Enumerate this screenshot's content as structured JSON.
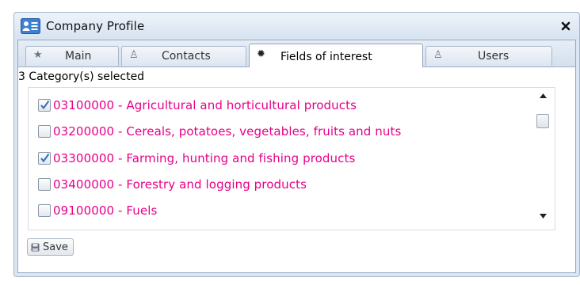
{
  "window": {
    "title": "Company Profile",
    "close_glyph": "✖"
  },
  "tabs": [
    {
      "label": "Main",
      "icon": "star-icon",
      "glyph": "★",
      "active": false
    },
    {
      "label": "Contacts",
      "icon": "person-icon",
      "glyph": "♙",
      "active": false
    },
    {
      "label": "Fields of interest",
      "icon": "gear-icon",
      "glyph": "✹",
      "active": true
    },
    {
      "label": "Users",
      "icon": "person-icon",
      "glyph": "♙",
      "active": false
    }
  ],
  "status_text": "3 Category(s) selected",
  "categories": [
    {
      "label": "03100000 - Agricultural and horticultural products",
      "checked": true
    },
    {
      "label": "03200000 - Cereals, potatoes, vegetables, fruits and nuts",
      "checked": false
    },
    {
      "label": "03300000 - Farming, hunting and fishing products",
      "checked": true
    },
    {
      "label": "03400000 - Forestry and logging products",
      "checked": false
    },
    {
      "label": "09100000 - Fuels",
      "checked": false
    }
  ],
  "save_label": "Save",
  "colors": {
    "item_text": "#e8008a",
    "window_bg": "#dce6f3",
    "accent": "#2f6fc0"
  }
}
